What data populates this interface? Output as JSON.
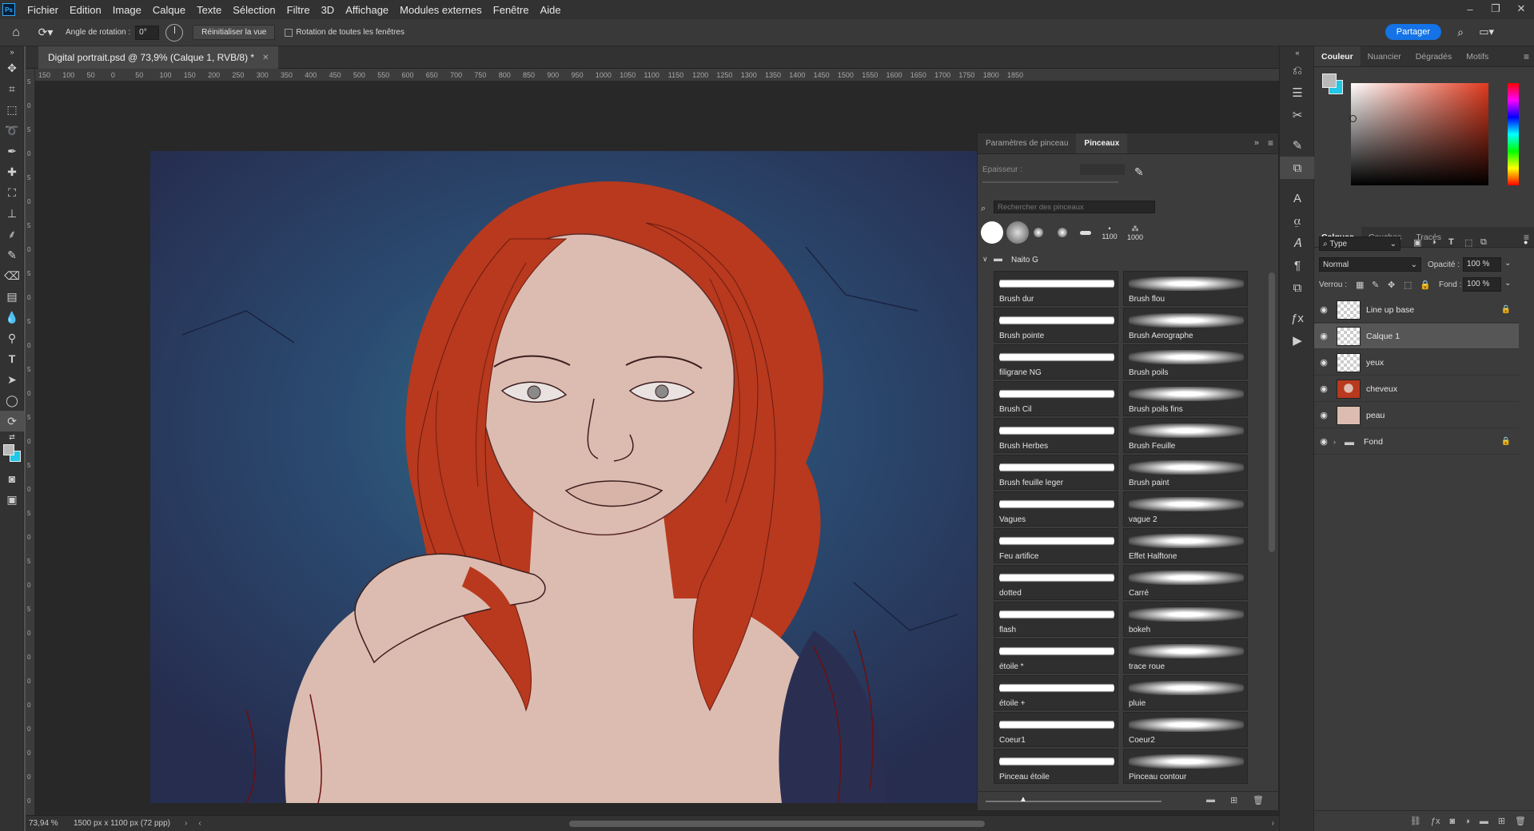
{
  "app": {
    "logo": "Ps"
  },
  "menu": [
    "Fichier",
    "Edition",
    "Image",
    "Calque",
    "Texte",
    "Sélection",
    "Filtre",
    "3D",
    "Affichage",
    "Modules externes",
    "Fenêtre",
    "Aide"
  ],
  "options": {
    "rotation_label": "Angle de rotation :",
    "rotation_value": "0°",
    "reset_view": "Réinitialiser la vue",
    "rotate_all": "Rotation de toutes les fenêtres",
    "share": "Partager"
  },
  "document": {
    "tab_title": "Digital portrait.psd @ 73,9% (Calque 1, RVB/8) *",
    "zoom": "73,94 %",
    "doc_size": "1500 px x 1100 px (72 ppp)"
  },
  "ruler_ticks": [
    "150",
    "100",
    "50",
    "0",
    "50",
    "100",
    "150",
    "200",
    "250",
    "300",
    "350",
    "400",
    "450",
    "500",
    "550",
    "600",
    "650",
    "700",
    "750",
    "800",
    "850",
    "900",
    "950",
    "1000",
    "1050",
    "1100",
    "1150",
    "1200",
    "1250",
    "1300",
    "1350",
    "1400",
    "1450",
    "1500",
    "1550",
    "1600",
    "1650",
    "1700",
    "1750",
    "1800",
    "1850"
  ],
  "vruler_ticks": [
    "5",
    "0",
    "5",
    "0",
    "5",
    "0",
    "5",
    "0",
    "5",
    "0",
    "5",
    "0",
    "5",
    "0",
    "5",
    "0",
    "5",
    "0",
    "5",
    "0",
    "5",
    "0",
    "5",
    "0",
    "0",
    "0",
    "0",
    "0",
    "0",
    "0",
    "0"
  ],
  "brush_panel": {
    "tabs": [
      "Paramètres de pinceau",
      "Pinceaux"
    ],
    "active_tab": "Pinceaux",
    "size_label": "Epaisseur :",
    "search_placeholder": "Rechercher des pinceaux",
    "preset_sizes": [
      "1100",
      "1000"
    ],
    "group_name": "Naito G",
    "brushes": [
      "Brush dur",
      "Brush flou",
      "Brush pointe",
      "Brush Aerographe",
      "filigrane NG",
      "Brush poils",
      "Brush Cil",
      "Brush poils fins",
      "Brush Herbes",
      "Brush Feuille",
      "Brush feuille leger",
      "Brush paint",
      "Vagues",
      "vague 2",
      "Feu artifice",
      "Effet Halftone",
      "dotted",
      "Carré",
      "flash",
      "bokeh",
      "étoile *",
      "trace roue",
      "étoile +",
      "pluie",
      "Coeur1",
      "Coeur2",
      "Pinceau étoile",
      "Pinceau contour"
    ]
  },
  "color_panel": {
    "tabs": [
      "Couleur",
      "Nuancier",
      "Dégradés",
      "Motifs"
    ],
    "active_tab": "Couleur",
    "foreground": "#b9b9b9",
    "background": "#1ec8e6"
  },
  "layers_panel": {
    "tabs": [
      "Calques",
      "Couches",
      "Tracés"
    ],
    "active_tab": "Calques",
    "filter": "Type",
    "blend_mode": "Normal",
    "opacity_label": "Opacité :",
    "opacity": "100 %",
    "lock_label": "Verrou :",
    "fill_label": "Fond :",
    "fill": "100 %",
    "layers": [
      {
        "name": "Line up base",
        "locked": true,
        "selected": false
      },
      {
        "name": "Calque 1",
        "locked": false,
        "selected": true
      },
      {
        "name": "yeux",
        "locked": false,
        "selected": false
      },
      {
        "name": "cheveux",
        "locked": false,
        "selected": false
      },
      {
        "name": "peau",
        "locked": false,
        "selected": false
      },
      {
        "name": "Fond",
        "locked": true,
        "selected": false
      }
    ]
  },
  "colors": {
    "accent": "#1473e6",
    "hair": "#b8391e",
    "skin": "#dcbcb0",
    "bg_dark": "#2b3557"
  }
}
